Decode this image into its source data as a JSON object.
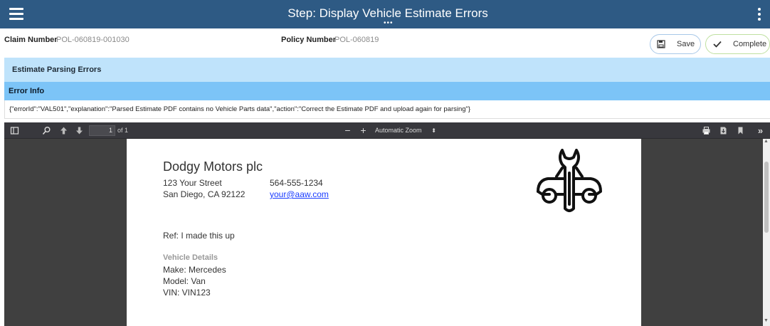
{
  "header": {
    "title": "Step: Display Vehicle Estimate Errors",
    "menu_icon": "hamburger-menu-icon",
    "more_icon": "vertical-dots-icon"
  },
  "claim": {
    "claim_label": "Claim Number",
    "claim_value": "POL-060819-001030",
    "policy_label": "Policy Number",
    "policy_value": "POL-060819"
  },
  "actions": {
    "save_label": "Save",
    "complete_label": "Complete"
  },
  "errors": {
    "section_title": "Estimate Parsing Errors",
    "info_title": "Error Info",
    "info_text": "{\"errorId\":\"VAL501\",\"explanation\":\"Parsed Estimate PDF contains no Vehicle Parts data\",\"action\":\"Correct the Estimate PDF and upload again for parsing\"}"
  },
  "pdf_toolbar": {
    "page_number": "1",
    "page_total": "of 1",
    "zoom": "Automatic Zoom"
  },
  "document": {
    "company": "Dodgy Motors plc",
    "street": "123 Your Street",
    "city": "San Diego, CA 92122",
    "phone": "564-555-1234",
    "email": "your@aaw.com",
    "ref": "Ref: I made this up",
    "vehicle_heading": "Vehicle Details",
    "make": "Make: Mercedes",
    "model": "Model: Van",
    "vin": "VIN: VIN123"
  },
  "colors": {
    "header_bg": "#2e5a84",
    "panel_light": "#bfe3fb",
    "panel_mid": "#7cc4f7",
    "viewer_bg": "#404040"
  }
}
